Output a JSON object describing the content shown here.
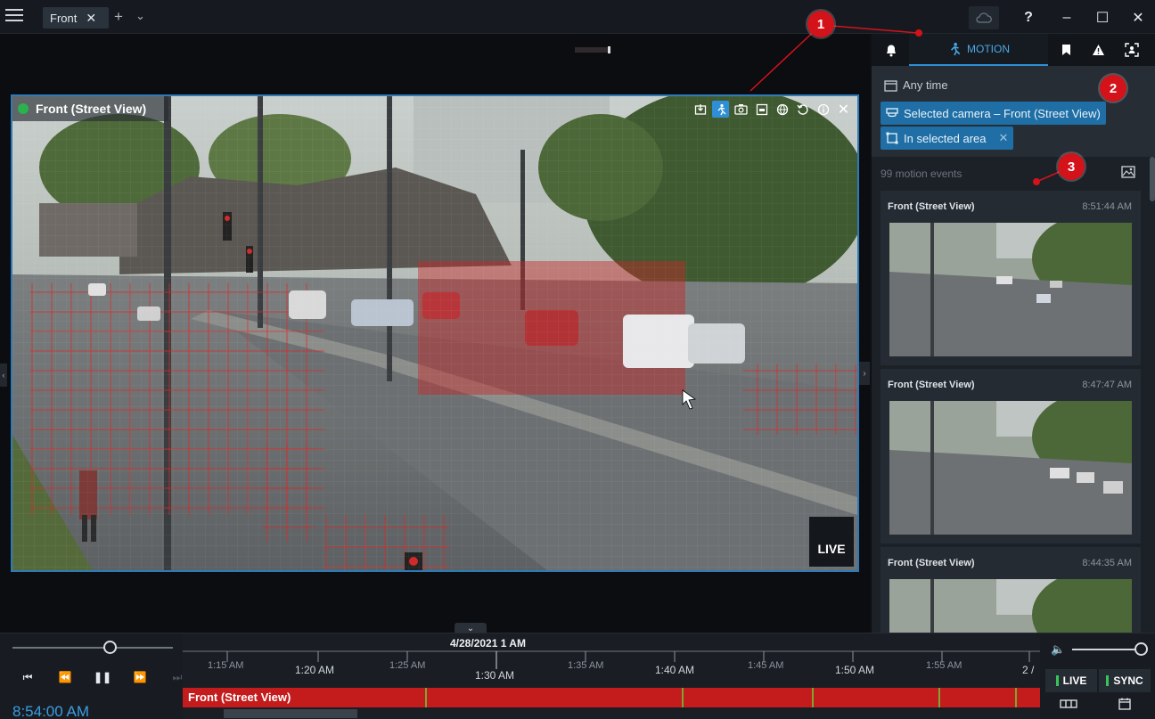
{
  "tabs": [
    {
      "label": "Front",
      "close": "✕"
    }
  ],
  "window_controls": {
    "help": "?",
    "minimize": "–",
    "maximize": "☐",
    "close": "✕"
  },
  "video": {
    "title": "Front (Street View)",
    "live_badge": "LIVE"
  },
  "annotations": [
    "1",
    "2",
    "3"
  ],
  "right_panel": {
    "active_tab": "MOTION",
    "filters": {
      "time": "Any time",
      "camera_chip": "Selected camera – Front (Street View)",
      "area_chip": "In selected area"
    },
    "event_count": "99 motion events",
    "events": [
      {
        "camera": "Front (Street View)",
        "time": "8:51:44 AM"
      },
      {
        "camera": "Front (Street View)",
        "time": "8:47:47 AM"
      },
      {
        "camera": "Front (Street View)",
        "time": "8:44:35 AM"
      }
    ]
  },
  "timeline": {
    "date_label": "4/28/2021 1 AM",
    "ticks_minor": [
      "1:15 AM",
      "1:25 AM",
      "1:35 AM",
      "1:45 AM",
      "1:55 AM"
    ],
    "ticks_major": [
      "1:20 AM",
      "1:30 AM",
      "1:40 AM",
      "1:50 AM",
      "2 /"
    ],
    "track_label": "Front (Street View)",
    "current_time": "8:54:00 AM",
    "live_label": "LIVE",
    "sync_label": "SYNC"
  },
  "colors": {
    "accent": "#2f8fd6",
    "motion_red": "#c41c1c",
    "annotation": "#d4121a"
  }
}
